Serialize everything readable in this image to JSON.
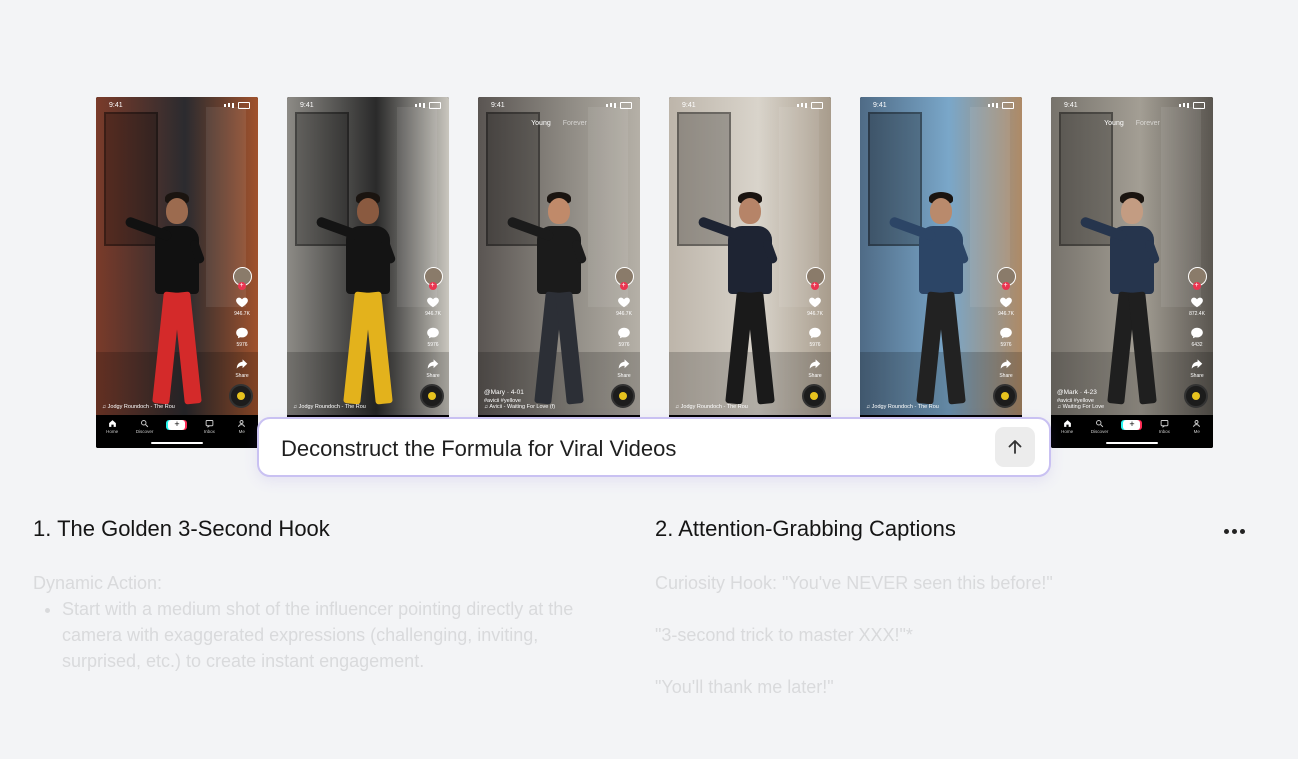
{
  "phones": [
    {
      "time": "9:41",
      "likes": "946.7K",
      "comments": "5976",
      "shares": "Share",
      "music": "Jodgy Roundoch - The Rou",
      "bg": [
        "#7a3b2a",
        "#2b2b2f",
        "#a0522d"
      ],
      "outfit": {
        "jacket": "#111111",
        "pants": "#d42a2a",
        "skin": "#9c6b4f"
      }
    },
    {
      "time": "9:41",
      "likes": "946.7K",
      "comments": "5976",
      "shares": "Share",
      "music": "Jodgy Roundoch - The Rou",
      "bg": [
        "#8d8b86",
        "#2a2a2a",
        "#c9c6be"
      ],
      "outfit": {
        "jacket": "#141414",
        "pants": "#e3b21c",
        "skin": "#8a5a40"
      }
    },
    {
      "time": "9:41",
      "tabs": [
        "Young",
        "Forever"
      ],
      "likes": "946.7K",
      "comments": "5976",
      "shares": "Share",
      "user": "@Mary · 4-01",
      "desc": "#avicii #yellove",
      "music": "Avicii - Waiting For Love (f)",
      "bg": [
        "#5a5552",
        "#8e8a83",
        "#b5b0a7"
      ],
      "outfit": {
        "jacket": "#1b1b1b",
        "pants": "#2c2f36",
        "skin": "#c08a6a"
      }
    },
    {
      "time": "9:41",
      "likes": "946.7K",
      "comments": "5976",
      "shares": "Share",
      "music": "Jodgy Roundoch - The Rou",
      "bg": [
        "#bdb5aa",
        "#d9d4cb",
        "#a89c8c"
      ],
      "outfit": {
        "jacket": "#1e2433",
        "pants": "#1a1a1a",
        "skin": "#b68468"
      }
    },
    {
      "time": "9:41",
      "likes": "946.7K",
      "comments": "5976",
      "shares": "Share",
      "music": "Jodgy Roundoch - The Rou",
      "bg": [
        "#4f6b86",
        "#7aa7c9",
        "#ae8a66"
      ],
      "outfit": {
        "jacket": "#2c4566",
        "pants": "#222222",
        "skin": "#b98a6c"
      }
    },
    {
      "time": "9:41",
      "tabs": [
        "Young",
        "Forever"
      ],
      "likes": "872.4K",
      "comments": "6432",
      "shares": "Share",
      "user": "@Mark · 4-23",
      "desc": "#avicii #yellove",
      "music": "Waiting For Love",
      "bg": [
        "#77736c",
        "#a39e94",
        "#5a5650"
      ],
      "outfit": {
        "jacket": "#26354d",
        "pants": "#1f1f1f",
        "skin": "#c39c82"
      }
    }
  ],
  "nav": [
    "Home",
    "Discover",
    "",
    "Inbox",
    "Me"
  ],
  "prompt": {
    "text": "Deconstruct the Formula for Viral Videos"
  },
  "section1": {
    "title": "1. The Golden 3-Second Hook",
    "label": "Dynamic Action:",
    "bullet": "Start with a medium shot of the influencer pointing directly at the camera with exaggerated expressions (challenging, inviting, surprised, etc.) to create instant engagement."
  },
  "section2": {
    "title": "2. Attention-Grabbing Captions",
    "line1": "Curiosity Hook:   \"You've NEVER seen this before!\"",
    "line2": "\"3-second trick to master XXX!\"*",
    "line3": "\"You'll thank me later!\""
  }
}
